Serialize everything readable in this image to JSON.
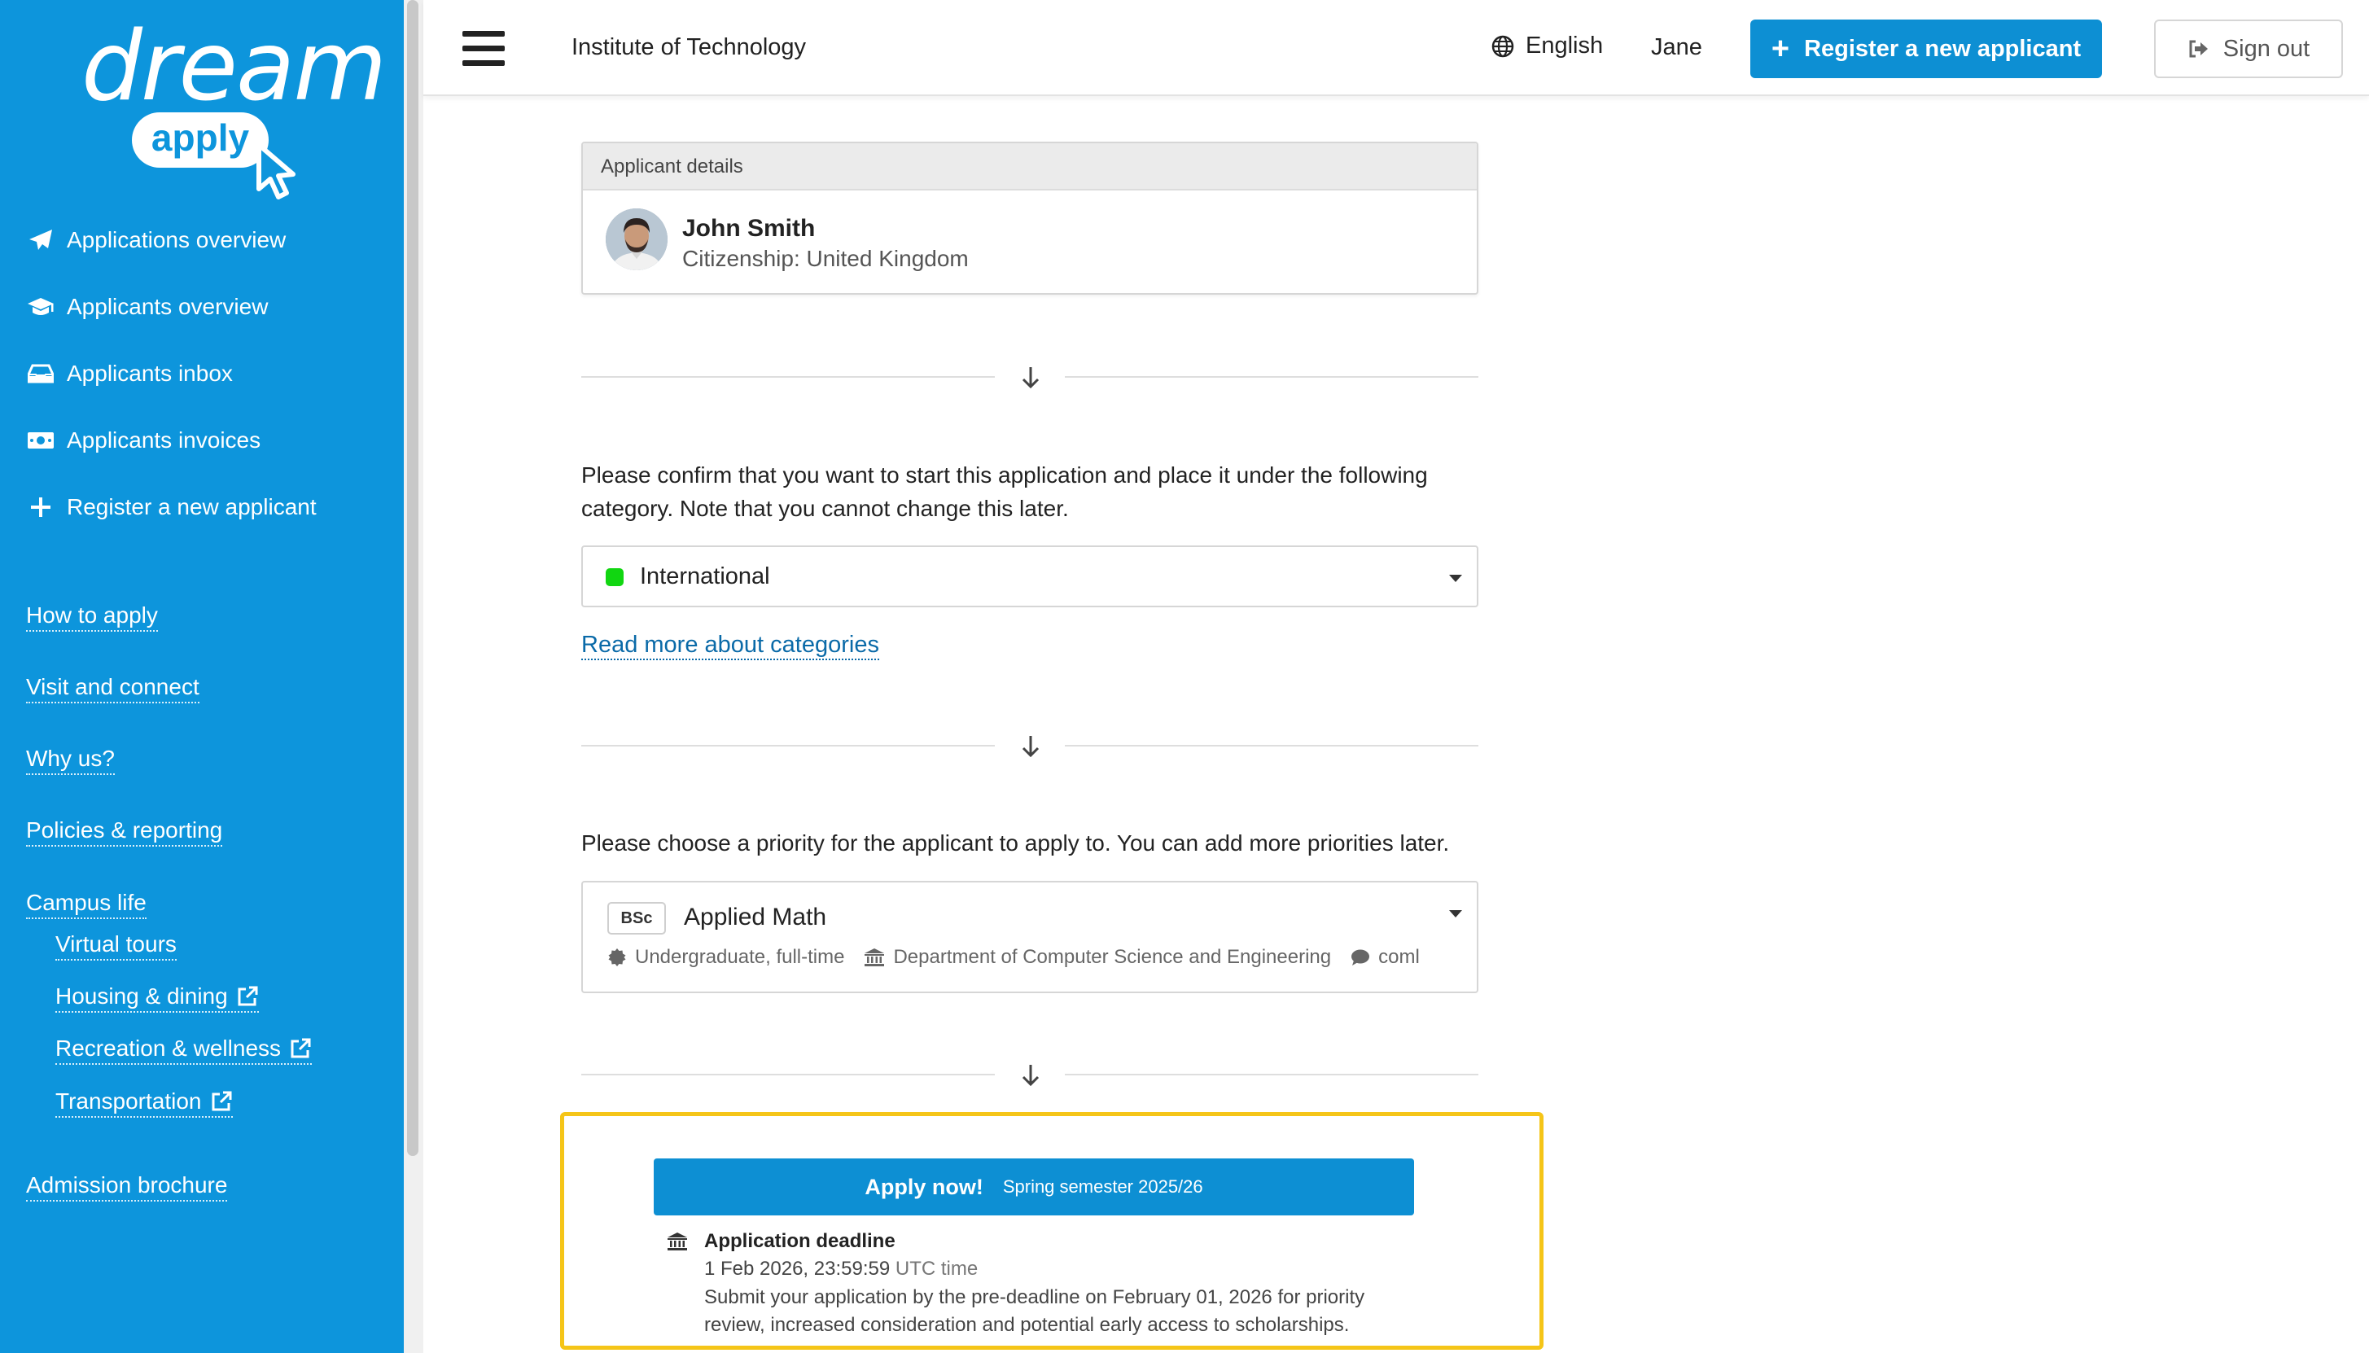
{
  "brand": {
    "wordmark": "dream",
    "tag": "apply",
    "color": "#0d95dc"
  },
  "sidebar": {
    "nav": [
      {
        "label": "Applications overview",
        "icon": "paper-plane-icon"
      },
      {
        "label": "Applicants overview",
        "icon": "graduation-cap-icon"
      },
      {
        "label": "Applicants inbox",
        "icon": "inbox-icon"
      },
      {
        "label": "Applicants invoices",
        "icon": "money-bill-icon"
      },
      {
        "label": "Register a new applicant",
        "icon": "plus-icon"
      }
    ],
    "links": [
      {
        "label": "How to apply"
      },
      {
        "label": "Visit and connect"
      },
      {
        "label": "Why us?"
      },
      {
        "label": "Policies & reporting"
      },
      {
        "label": "Campus life"
      },
      {
        "label": "Virtual tours"
      },
      {
        "label": "Housing & dining",
        "external": true
      },
      {
        "label": "Recreation & wellness",
        "external": true
      },
      {
        "label": "Transportation",
        "external": true
      },
      {
        "label": "Admission brochure"
      }
    ]
  },
  "topbar": {
    "institution": "Institute of Technology",
    "language": "English",
    "user": "Jane",
    "register_label": "Register a new applicant",
    "signout_label": "Sign out"
  },
  "applicant": {
    "section_title": "Applicant details",
    "name": "John Smith",
    "citizenship": "Citizenship: United Kingdom"
  },
  "category": {
    "prompt": "Please confirm that you want to start this application and place it under the following category. Note that you cannot change this later.",
    "selected": "International",
    "selected_color": "#11d611",
    "read_more": "Read more about categories"
  },
  "priority": {
    "prompt": "Please choose a priority for the applicant to apply to. You can add more priorities later.",
    "degree": "BSc",
    "title": "Applied Math",
    "level": "Undergraduate, full-time",
    "department": "Department of Computer Science and Engineering",
    "extra": "coml"
  },
  "apply": {
    "button_label": "Apply now!",
    "semester": "Spring semester 2025/26",
    "deadline_title": "Application deadline",
    "deadline_date": "1 Feb 2026, 23:59:59",
    "deadline_tz": "UTC time",
    "deadline_desc": "Submit your application by the pre-deadline on February 01, 2026 for priority review, increased consideration and potential early access to scholarships.",
    "highlight_color": "#f5c518"
  }
}
